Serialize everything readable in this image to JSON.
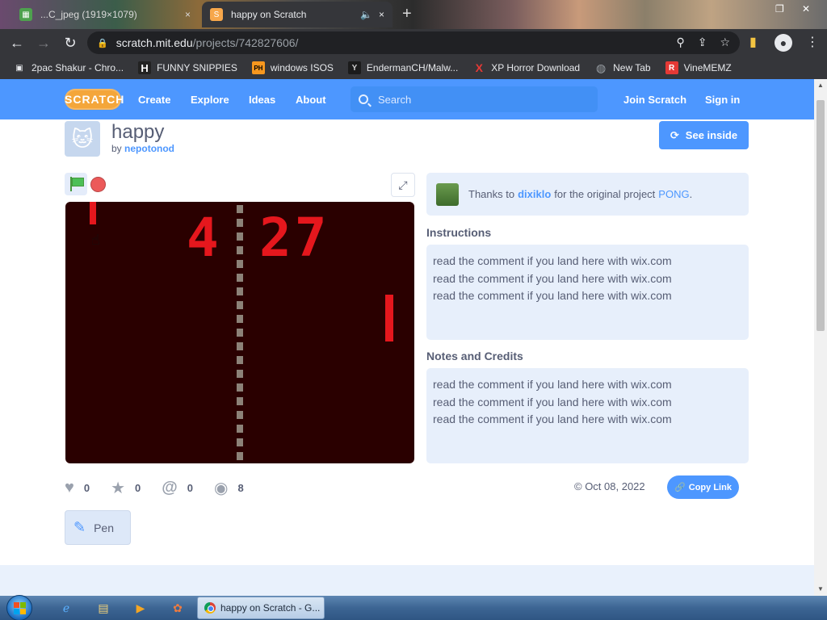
{
  "browser": {
    "tabs": [
      {
        "title": "...C_jpeg (1919×1079)",
        "active": false,
        "close_icon": "×"
      },
      {
        "title": "happy on Scratch",
        "active": true,
        "audio_icon": "🔈",
        "close_icon": "×"
      }
    ],
    "new_tab_icon": "+",
    "url_host": "scratch.mit.edu",
    "url_path": "/projects/742827606/",
    "nav": {
      "back": "←",
      "forward": "→",
      "reload": "↻"
    },
    "bookmarks": [
      {
        "label": "2pac Shakur - Chro...",
        "icon": "▣",
        "color": "#e8eaed"
      },
      {
        "label": "FUNNY SNIPPIES",
        "icon": "H",
        "color": "#ffffff"
      },
      {
        "label": "windows ISOS",
        "icon": "PH",
        "color": "#f7971e"
      },
      {
        "label": "EndermanCH/Malw...",
        "icon": "Y",
        "color": "#cfcfcf"
      },
      {
        "label": "XP Horror Download",
        "icon": "X",
        "color": "#e53935"
      },
      {
        "label": "New Tab",
        "icon": "◍",
        "color": "#9aa0a6"
      },
      {
        "label": "VineMEMZ",
        "icon": "R",
        "color": "#e53935"
      }
    ]
  },
  "scratch": {
    "logo": "SCRATCH",
    "nav": {
      "create": "Create",
      "explore": "Explore",
      "ideas": "Ideas",
      "about": "About",
      "join": "Join Scratch",
      "signin": "Sign in"
    },
    "search_placeholder": "Search",
    "project": {
      "title": "happy",
      "by_prefix": "by",
      "author": "nepotonod",
      "see_inside": "See inside",
      "see_inside_icon": "⟳"
    },
    "stage": {
      "left_score": "4",
      "right_score": "27"
    },
    "thanks": {
      "prefix": "Thanks to",
      "user": "dixiklo",
      "middle": "for the original project",
      "project": "PONG",
      "suffix": "."
    },
    "instructions_heading": "Instructions",
    "instructions": [
      "read the comment if you land here with wix.com",
      "read the comment if you land here with wix.com",
      "read the comment if you land here with wix.com"
    ],
    "notes_heading": "Notes and Credits",
    "notes": [
      "read the comment if you land here with wix.com",
      "read the comment if you land here with wix.com",
      "read the comment if you land here with wix.com"
    ],
    "stats": {
      "loves": "0",
      "favorites": "0",
      "remixes": "0",
      "views": "8"
    },
    "date": "© Oct 08, 2022",
    "copy_link": "Copy Link",
    "extension_tag": "Pen"
  },
  "taskbar": {
    "active_task": "happy on Scratch - G..."
  },
  "colors": {
    "scratch_blue": "#4d97ff",
    "stage_bg": "#2a0000",
    "pong_red": "#e5171d"
  }
}
